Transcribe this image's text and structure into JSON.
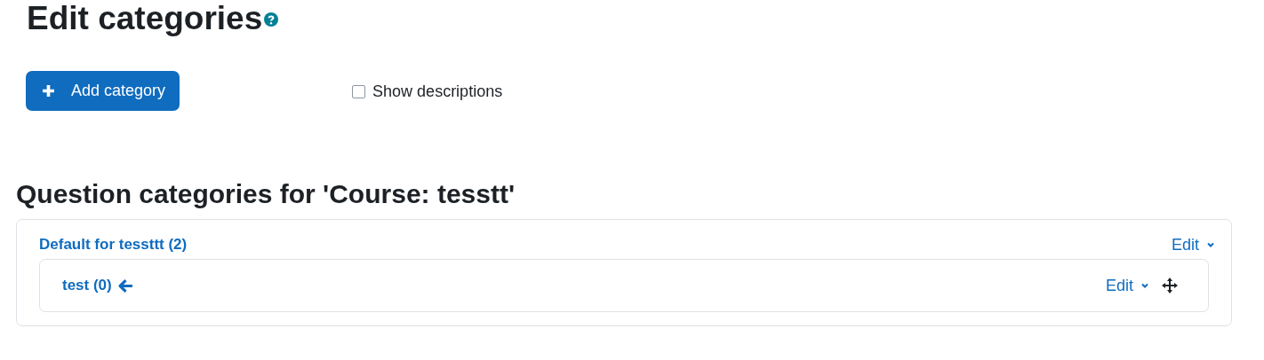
{
  "title": "Edit categories",
  "add_button": {
    "label": "Add category"
  },
  "show_descriptions": {
    "label": "Show descriptions",
    "checked": false
  },
  "section_title": "Question categories for 'Course: tesstt'",
  "categories": [
    {
      "name": "Default for tessttt (2)",
      "action": "Edit",
      "movable": false,
      "children": [
        {
          "name": "test (0)",
          "action": "Edit",
          "movable": true
        }
      ]
    }
  ]
}
